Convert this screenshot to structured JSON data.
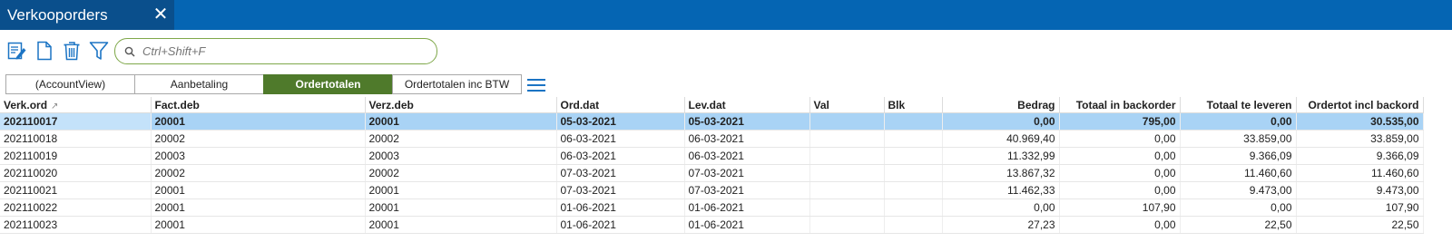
{
  "window": {
    "title": "Verkooporders",
    "close_label": "✕"
  },
  "toolbar": {
    "icons": [
      "edit-icon",
      "new-document-icon",
      "delete-icon",
      "filter-icon"
    ]
  },
  "search": {
    "placeholder": "Ctrl+Shift+F",
    "value": ""
  },
  "views": {
    "tabs": [
      {
        "label": "(AccountView)",
        "active": false
      },
      {
        "label": "Aanbetaling",
        "active": false
      },
      {
        "label": "Ordertotalen",
        "active": true
      },
      {
        "label": "Ordertotalen inc BTW",
        "active": false
      }
    ],
    "menu_icon": "hamburger-menu-icon"
  },
  "colors": {
    "titlebar": "#0565b3",
    "active_tab": "#0a4f8c",
    "active_view": "#4f7a2b",
    "selected_row": "#a9d3f5",
    "search_border": "#7fa84a"
  },
  "table": {
    "columns": [
      {
        "label": "Verk.ord",
        "sort": "ascending"
      },
      {
        "label": "Fact.deb"
      },
      {
        "label": "Verz.deb"
      },
      {
        "label": "Ord.dat"
      },
      {
        "label": "Lev.dat"
      },
      {
        "label": "Val"
      },
      {
        "label": "Blk"
      },
      {
        "label": "Bedrag"
      },
      {
        "label": "Totaal in backorder"
      },
      {
        "label": "Totaal te leveren"
      },
      {
        "label": "Ordertot incl backord"
      }
    ],
    "sort_indicator": "↗",
    "selected_row": 0,
    "rows": [
      [
        "202110017",
        "20001",
        "20001",
        "05-03-2021",
        "05-03-2021",
        "",
        "",
        "0,00",
        "795,00",
        "0,00",
        "30.535,00"
      ],
      [
        "202110018",
        "20002",
        "20002",
        "06-03-2021",
        "06-03-2021",
        "",
        "",
        "40.969,40",
        "0,00",
        "33.859,00",
        "33.859,00"
      ],
      [
        "202110019",
        "20003",
        "20003",
        "06-03-2021",
        "06-03-2021",
        "",
        "",
        "11.332,99",
        "0,00",
        "9.366,09",
        "9.366,09"
      ],
      [
        "202110020",
        "20002",
        "20002",
        "07-03-2021",
        "07-03-2021",
        "",
        "",
        "13.867,32",
        "0,00",
        "11.460,60",
        "11.460,60"
      ],
      [
        "202110021",
        "20001",
        "20001",
        "07-03-2021",
        "07-03-2021",
        "",
        "",
        "11.462,33",
        "0,00",
        "9.473,00",
        "9.473,00"
      ],
      [
        "202110022",
        "20001",
        "20001",
        "01-06-2021",
        "01-06-2021",
        "",
        "",
        "0,00",
        "107,90",
        "0,00",
        "107,90"
      ],
      [
        "202110023",
        "20001",
        "20001",
        "01-06-2021",
        "01-06-2021",
        "",
        "",
        "27,23",
        "0,00",
        "22,50",
        "22,50"
      ]
    ]
  }
}
